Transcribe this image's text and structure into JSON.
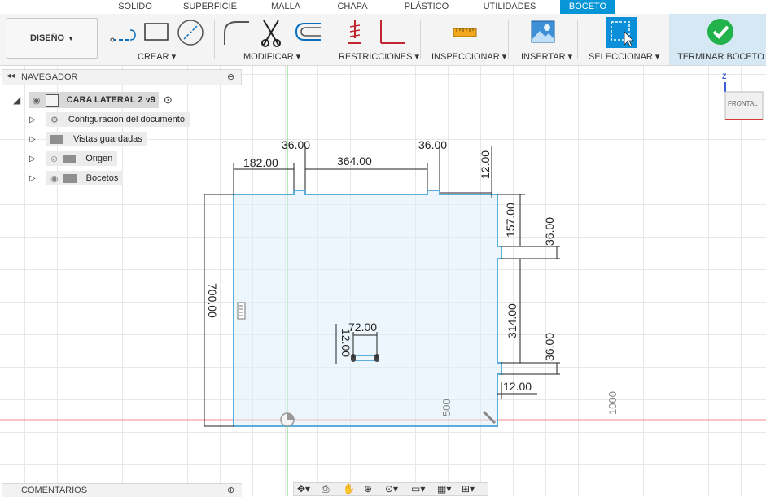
{
  "tabs": [
    "SOLIDO",
    "SUPERFICIE",
    "MALLA",
    "CHAPA",
    "PLÁSTICO",
    "UTILIDADES",
    "BOCETO"
  ],
  "active_tab": "BOCETO",
  "workspace_button": "DISEÑO",
  "toolbar_groups": {
    "create": "CREAR",
    "modify": "MODIFICAR",
    "constraints": "RESTRICCIONES",
    "inspect": "INSPECCIONAR",
    "insert": "INSERTAR",
    "select": "SELECCIONAR",
    "finish": "TERMINAR BOCETO"
  },
  "navigator": {
    "title": "NAVEGADOR",
    "root": "CARA LATERAL 2 v9",
    "items": [
      "Configuración del documento",
      "Vistas guardadas",
      "Origen",
      "Bocetos"
    ]
  },
  "comments_label": "COMENTARIOS",
  "view_cube_label": "FRONTAL",
  "axis_label": "Z",
  "dimensions": {
    "d182": "182.00",
    "d36_top_left": "36.00",
    "d364": "364.00",
    "d36_top_right": "36.00",
    "d12_top": "12.00",
    "d700": "700.00",
    "d157": "157.00",
    "d36_right_top": "36.00",
    "d314": "314.00",
    "d36_right_bottom": "36.00",
    "d12_right": "12.00",
    "d72": "72.00",
    "d12_slot": "12.00"
  },
  "grid_labels": {
    "g500": "500",
    "g1000": "1000"
  },
  "colors": {
    "accent": "#0696d7",
    "sketch_line": "#5aaedc",
    "profile_fill": "#dceefa",
    "finish_check": "#21b24b"
  }
}
